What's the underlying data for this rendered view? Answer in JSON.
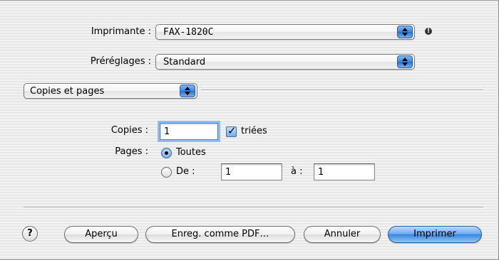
{
  "printer": {
    "label": "Imprimante :",
    "value": "FAX-1820C",
    "status_icon": "warning-icon"
  },
  "presets": {
    "label": "Préréglages :",
    "value": "Standard"
  },
  "pane_selector": {
    "value": "Copies et pages"
  },
  "copies": {
    "label": "Copies :",
    "value": "1",
    "collated_label": "triées",
    "collated_checked": true
  },
  "pages": {
    "label": "Pages :",
    "all_label": "Toutes",
    "all_selected": true,
    "range_label": "De :",
    "from_value": "1",
    "to_label": "à :",
    "to_value": "1"
  },
  "buttons": {
    "help": "?",
    "preview": "Aperçu",
    "save_pdf": "Enreg. comme PDF…",
    "cancel": "Annuler",
    "print": "Imprimer"
  }
}
